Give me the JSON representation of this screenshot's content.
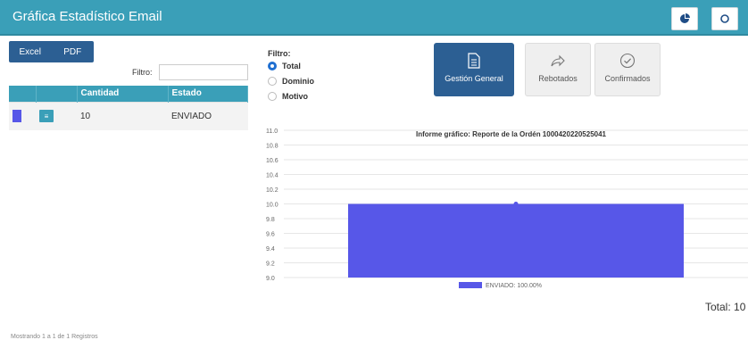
{
  "header": {
    "title": "Gráfica Estadístico Email"
  },
  "export": {
    "excel": "Excel",
    "pdf": "PDF"
  },
  "left": {
    "filter_label": "Filtro:"
  },
  "table": {
    "columns": [
      "",
      "",
      "Cantidad",
      "Estado"
    ],
    "rows": [
      {
        "cantidad": "10",
        "estado": "ENVIADO",
        "color": "#5757e8"
      }
    ]
  },
  "filter": {
    "title": "Filtro:",
    "options": [
      "Total",
      "Dominio",
      "Motivo"
    ],
    "selected": "Total"
  },
  "cards": {
    "general": "Gestión General",
    "rebotados": "Rebotados",
    "confirmados": "Confirmados"
  },
  "chart_data": {
    "type": "bar",
    "title": "Informe gráfico: Reporte de la Ordén 1000420220525041",
    "categories": [
      "ENVIADO"
    ],
    "values": [
      10
    ],
    "ylim": [
      9.0,
      11.0
    ],
    "yticks": [
      "9.0",
      "9.2",
      "9.4",
      "9.6",
      "9.8",
      "10.0",
      "10.2",
      "10.4",
      "10.6",
      "10.8",
      "11.0"
    ],
    "legend": "ENVIADO: 100.00%",
    "legend_position": "bottom",
    "grid": true,
    "color": "#5757e8"
  },
  "summary": {
    "total": "Total: 10"
  },
  "footer": {
    "note": "Mostrando 1 a 1 de 1 Registros"
  }
}
